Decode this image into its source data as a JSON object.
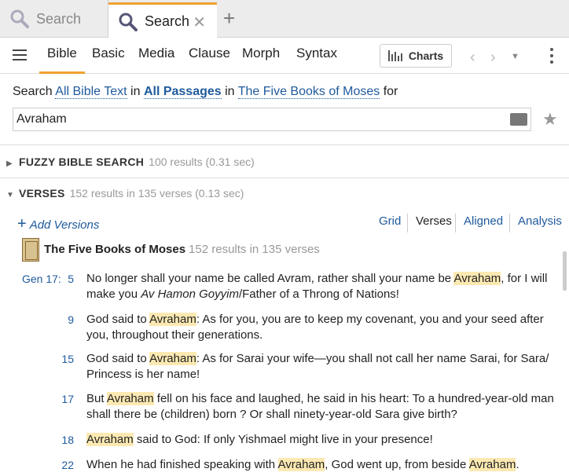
{
  "tabs": [
    {
      "label": "Search",
      "icon": "search-icon"
    },
    {
      "label": "Search",
      "icon": "search-icon",
      "close": "✕"
    }
  ],
  "tab_add": "+",
  "toolbar": {
    "tabs": [
      "Bible",
      "Basic",
      "Media",
      "Clause",
      "Morph",
      "Syntax"
    ],
    "active_tab": "Bible",
    "charts_label": "Charts"
  },
  "search_line": {
    "prefix": "Search",
    "scope": "All Bible Text",
    "in1": "in",
    "passages": "All Passages",
    "in2": "in",
    "collection": "The Five Books of Moses",
    "for": "for"
  },
  "search_input": "Avraham",
  "fuzzy": {
    "title": "FUZZY BIBLE SEARCH",
    "meta": "100 results (0.31 sec)"
  },
  "verses_section": {
    "title": "VERSES",
    "meta": "152 results in 135 verses (0.13 sec)"
  },
  "add_versions": "Add Versions",
  "views": [
    "Grid",
    "Verses",
    "Aligned",
    "Analysis"
  ],
  "active_view": "Verses",
  "book": {
    "name": "The Five Books of Moses",
    "meta": "152 results in 135 verses"
  },
  "ref_chapter": "Gen 17:",
  "verses": [
    {
      "num": "5",
      "parts": [
        "No longer shall your name be called Avram, rather shall your name be ",
        "Avraham",
        ", for I will make you ",
        "Av Hamon Goyyim",
        "/Father of a Throng of Nations!"
      ]
    },
    {
      "num": "9",
      "parts": [
        "God said to ",
        "Avraham",
        ": As for you, you are to keep my covenant, you and your seed after you, throughout their generations."
      ]
    },
    {
      "num": "15",
      "parts": [
        "God said to ",
        "Avraham",
        ": As for Sarai your wife—you shall not call her name Sarai, for Sara/ Princess is her name!"
      ]
    },
    {
      "num": "17",
      "parts": [
        "But ",
        "Avraham",
        " fell on his face and laughed, he said in his heart: To a hundred-year-old man shall there be (children) born ? Or shall ninety-year-old Sara give birth?"
      ]
    },
    {
      "num": "18",
      "parts": [
        "",
        "Avraham",
        " said to God: If only Yishmael might live in your presence!"
      ]
    },
    {
      "num": "22",
      "parts": [
        "When he had finished speaking with ",
        "Avraham",
        ", God went up, from beside ",
        "Avraham",
        "."
      ]
    }
  ]
}
